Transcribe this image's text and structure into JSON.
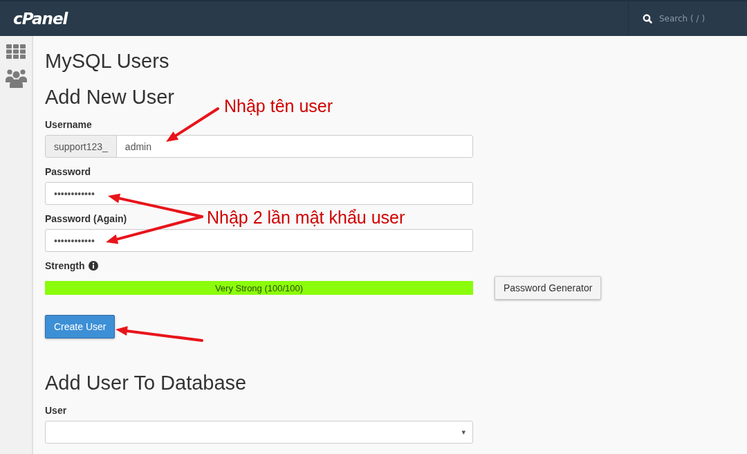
{
  "topbar": {
    "logo": "cPanel",
    "search": {
      "placeholder": "Search ( / )"
    }
  },
  "page": {
    "title": "MySQL Users"
  },
  "add_new_user": {
    "heading": "Add New User",
    "username": {
      "label": "Username",
      "prefix": "support123_",
      "value": "admin"
    },
    "password": {
      "label": "Password",
      "value": "••••••••••••"
    },
    "password_again": {
      "label": "Password (Again)",
      "value": "••••••••••••"
    },
    "strength": {
      "label": "Strength",
      "level": 1.0,
      "reading": "Very Strong (100/100)"
    },
    "generator_button": "Password Generator",
    "create_button": "Create User"
  },
  "add_user_to_database": {
    "heading": "Add User To Database",
    "user": {
      "label": "User",
      "caret": "▾"
    }
  },
  "annotations": [
    {
      "text": "Nhập tên user"
    },
    {
      "text": "Nhập 2 lần mật khẩu user"
    }
  ]
}
